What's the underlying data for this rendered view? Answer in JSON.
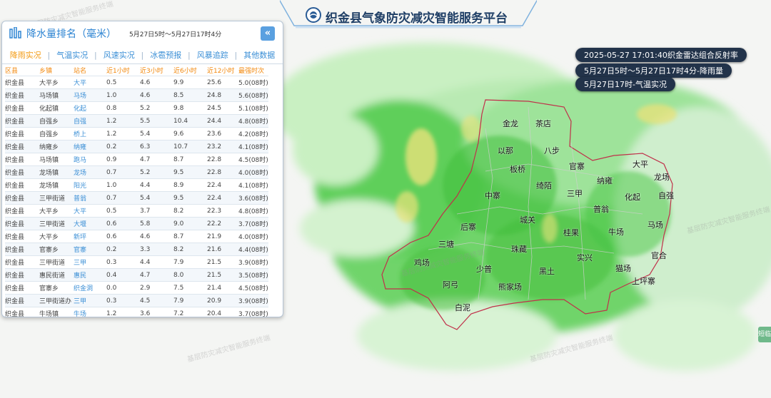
{
  "header": {
    "title": "织金县气象防灾减灾智能服务平台"
  },
  "info_labels": [
    "2025-05-27 17:01:40织金雷达组合反射率",
    "5月27日5时～5月27日17时4分-降雨量",
    "5月27日17时-气温实况"
  ],
  "panel": {
    "title": "降水量排名（毫米）",
    "date_range": "5月27日5时～5月27日17时4分",
    "collapse_label": "«",
    "tabs": [
      "降雨实况",
      "气温实况",
      "风速实况",
      "冰雹预报",
      "风暴追踪",
      "其他数据"
    ],
    "columns": [
      "区县",
      "乡镇",
      "站名",
      "近1小时",
      "近3小时",
      "近6小时",
      "近12小时",
      "最强时次"
    ],
    "rows": [
      [
        "织金县",
        "大平乡",
        "大平",
        "0.5",
        "4.6",
        "9.9",
        "25.6",
        "5.0(08时)"
      ],
      [
        "织金县",
        "马场镇",
        "马场",
        "1.0",
        "4.6",
        "8.5",
        "24.8",
        "5.6(08时)"
      ],
      [
        "织金县",
        "化起镇",
        "化起",
        "0.8",
        "5.2",
        "9.8",
        "24.5",
        "5.1(08时)"
      ],
      [
        "织金县",
        "自强乡",
        "自强",
        "1.2",
        "5.5",
        "10.4",
        "24.4",
        "4.8(08时)"
      ],
      [
        "织金县",
        "自强乡",
        "桥上",
        "1.2",
        "5.4",
        "9.6",
        "23.6",
        "4.2(08时)"
      ],
      [
        "织金县",
        "纳雍乡",
        "纳雍",
        "0.2",
        "6.3",
        "10.7",
        "23.2",
        "4.1(08时)"
      ],
      [
        "织金县",
        "马场镇",
        "跑马",
        "0.9",
        "4.7",
        "8.7",
        "22.8",
        "4.5(08时)"
      ],
      [
        "织金县",
        "龙场镇",
        "龙场",
        "0.7",
        "5.2",
        "9.5",
        "22.8",
        "4.0(08时)"
      ],
      [
        "织金县",
        "龙场镇",
        "阳光",
        "1.0",
        "4.4",
        "8.9",
        "22.4",
        "4.1(08时)"
      ],
      [
        "织金县",
        "三甲街道",
        "普翁",
        "0.7",
        "5.4",
        "9.5",
        "22.4",
        "3.6(08时)"
      ],
      [
        "织金县",
        "大平乡",
        "大平",
        "0.5",
        "3.7",
        "8.2",
        "22.3",
        "4.8(08时)"
      ],
      [
        "织金县",
        "三甲街道",
        "大堰",
        "0.6",
        "5.8",
        "9.0",
        "22.2",
        "3.7(08时)"
      ],
      [
        "织金县",
        "大平乡",
        "新坪",
        "0.6",
        "4.6",
        "8.7",
        "21.9",
        "4.0(08时)"
      ],
      [
        "织金县",
        "官寨乡",
        "官寨",
        "0.2",
        "3.3",
        "8.2",
        "21.6",
        "4.4(08时)"
      ],
      [
        "织金县",
        "三甲街道",
        "三甲",
        "0.3",
        "4.4",
        "7.9",
        "21.5",
        "3.9(08时)"
      ],
      [
        "织金县",
        "惠民街道",
        "惠民",
        "0.4",
        "4.7",
        "8.0",
        "21.5",
        "3.5(08时)"
      ],
      [
        "织金县",
        "官寨乡",
        "织金洞",
        "0.0",
        "2.9",
        "7.5",
        "21.4",
        "4.5(08时)"
      ],
      [
        "织金县",
        "三甲街道办",
        "三甲",
        "0.3",
        "4.5",
        "7.9",
        "20.9",
        "3.9(08时)"
      ],
      [
        "织金县",
        "牛场镇",
        "牛场",
        "1.2",
        "3.6",
        "7.2",
        "20.4",
        "3.7(08时)"
      ]
    ]
  },
  "map": {
    "towns": [
      "金龙",
      "茶店",
      "以那",
      "八步",
      "板桥",
      "官寨",
      "纳雍",
      "大平",
      "龙场",
      "绮陌",
      "三甲",
      "化起",
      "自强",
      "中寨",
      "普翁",
      "城关",
      "后寨",
      "桂果",
      "牛场",
      "马场",
      "三塘",
      "珠藏",
      "官合",
      "鸡场",
      "实兴",
      "少普",
      "黑土",
      "猫场",
      "阿弓",
      "熊家场",
      "上坪寨",
      "白泥"
    ],
    "watermark": "基层防灾减灾智能服务终端"
  },
  "side_button": {
    "label": "短临"
  }
}
